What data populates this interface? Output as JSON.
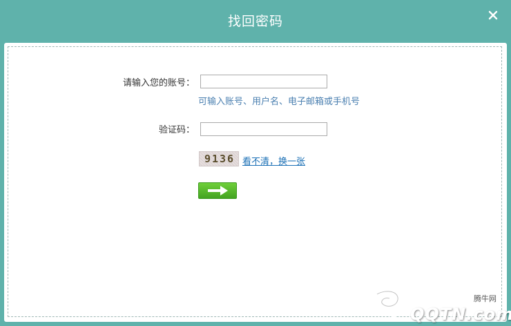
{
  "dialog": {
    "title": "找回密码",
    "close_glyph": "×"
  },
  "form": {
    "account_label": "请输入您的账号：",
    "account_value": "",
    "account_hint": "可输入账号、用户名、电子邮箱或手机号",
    "captcha_label": "验证码：",
    "captcha_value": "",
    "captcha_code": "9136",
    "refresh_link": "看不清，换一张",
    "submit_icon": "arrow-right-icon"
  },
  "watermark": {
    "logo_text": "QQTN.com",
    "cn_text": "腾牛网"
  },
  "colors": {
    "title_bar": "#5fb2ab",
    "hint": "#4a7fb0",
    "link": "#1a6fb5",
    "submit_button": "#4cb02a"
  }
}
